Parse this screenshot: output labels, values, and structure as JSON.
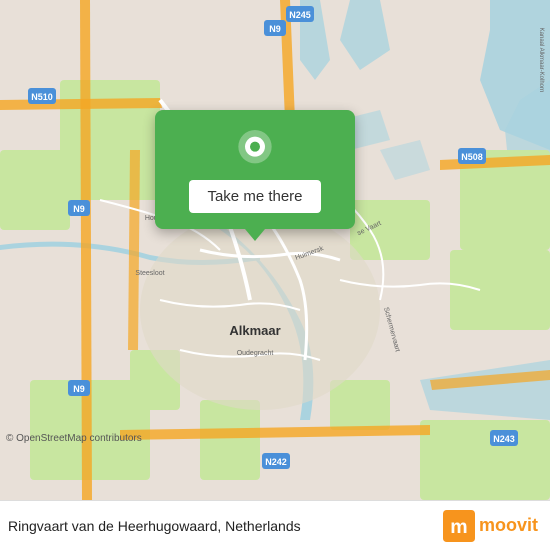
{
  "map": {
    "alt": "Map of Alkmaar area, Netherlands",
    "center_location": "Ringvaart van de Heerhugowaard, Netherlands"
  },
  "popup": {
    "button_label": "Take me there"
  },
  "bottom_bar": {
    "location_text": "Ringvaart van de Heerhugowaard, Netherlands",
    "copyright": "© OpenStreetMap contributors"
  },
  "branding": {
    "name": "moovit",
    "logo_alt": "Moovit logo"
  },
  "highways": [
    {
      "label": "N9"
    },
    {
      "label": "N510"
    },
    {
      "label": "N245"
    },
    {
      "label": "N242"
    },
    {
      "label": "N243"
    },
    {
      "label": "N508"
    }
  ],
  "city": {
    "name": "Alkmaar"
  }
}
